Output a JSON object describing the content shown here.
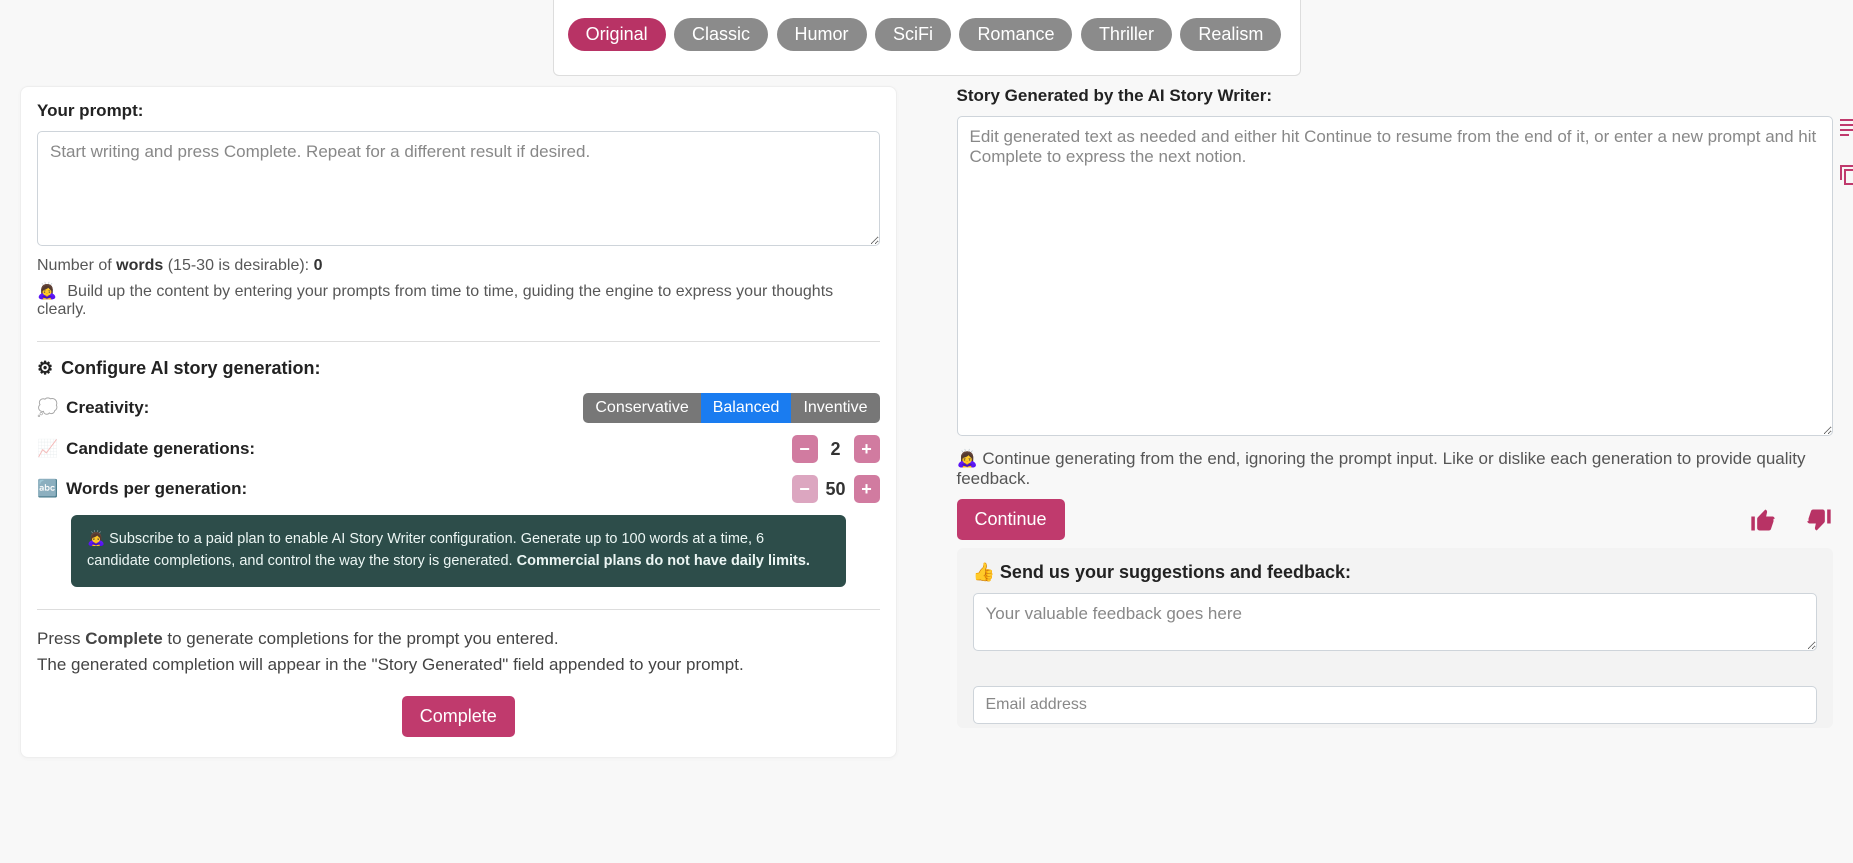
{
  "tabs": {
    "items": [
      "Original",
      "Classic",
      "Humor",
      "SciFi",
      "Romance",
      "Thriller",
      "Realism"
    ],
    "active_index": 0
  },
  "left": {
    "title": "Your prompt:",
    "prompt_placeholder": "Start writing and press Complete. Repeat for a different result if desired.",
    "word_count_prefix": "Number of ",
    "word_count_strong": "words",
    "word_count_suffix": " (15-30 is desirable): ",
    "word_count_value": "0",
    "build_hint_emoji": "🙇‍♀️",
    "build_hint": " Build up the content by entering your prompts from time to time, guiding the engine to express your thoughts clearly.",
    "config_title": "Configure AI story generation:",
    "config_icon": "⚙",
    "creativity": {
      "emoji": "💭",
      "label": "Creativity:",
      "options": [
        "Conservative",
        "Balanced",
        "Inventive"
      ],
      "active_index": 1
    },
    "candidates": {
      "emoji": "📈",
      "label": "Candidate generations:",
      "value": "2"
    },
    "words_per": {
      "emoji": "🔤",
      "label": "Words per generation:",
      "value": "50"
    },
    "notice_emoji": "🙇‍♀️",
    "notice_start": " Subscribe to a paid plan to enable AI Story Writer configuration. Generate up to 100 words at a time, 6 candidate completions, and control the way the story is generated. ",
    "notice_bold": "Commercial plans do not have daily limits.",
    "instr_press": "Press ",
    "instr_complete_word": "Complete",
    "instr_rem1": " to generate completions for the prompt you entered.",
    "instr_line2": "The generated completion will appear in the \"Story Generated\" field appended to your prompt.",
    "complete_label": "Complete"
  },
  "right": {
    "title": "Story Generated by the AI Story Writer:",
    "output_placeholder": "Edit generated text as needed and either hit Continue to resume from the end of it, or enter a new prompt and hit Complete to express the next notion.",
    "hint_emoji": "🙇‍♀️",
    "hint_text": " Continue generating from the end, ignoring the prompt input. Like or dislike each generation to provide quality feedback.",
    "continue_label": "Continue",
    "feedback_emoji": "👍",
    "feedback_head": " Send us your suggestions and feedback:",
    "feedback_placeholder": "Your valuable feedback goes here",
    "email_placeholder": "Email address"
  },
  "icons": {
    "minus": "−",
    "plus": "+"
  }
}
